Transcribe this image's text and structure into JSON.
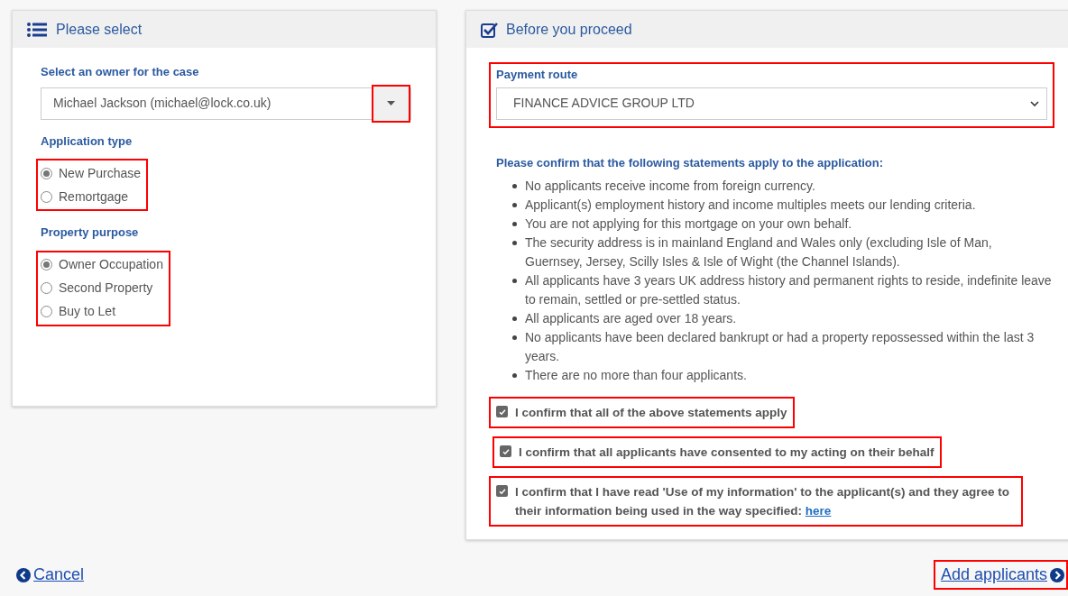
{
  "left_panel": {
    "title": "Please select",
    "owner": {
      "label": "Select an owner for the case",
      "value": "Michael Jackson (michael@lock.co.uk)",
      "button_highlighted": true
    },
    "radio_groups": [
      {
        "label": "Application type",
        "highlighted": true,
        "options": [
          {
            "label": "New Purchase",
            "selected": true
          },
          {
            "label": "Remortgage",
            "selected": false
          }
        ]
      },
      {
        "label": "Property purpose",
        "highlighted": true,
        "options": [
          {
            "label": "Owner Occupation",
            "selected": true
          },
          {
            "label": "Second Property",
            "selected": false
          },
          {
            "label": "Buy to Let",
            "selected": false
          }
        ]
      }
    ]
  },
  "right_panel": {
    "title": "Before you proceed",
    "payment_route": {
      "label": "Payment route",
      "value": "FINANCE ADVICE GROUP LTD",
      "highlighted": true
    },
    "statements_heading": "Please confirm that the following statements apply to the application:",
    "statements": [
      "No applicants receive income from foreign currency.",
      "Applicant(s) employment history and income multiples meets our lending criteria.",
      "You are not applying for this mortgage on your own behalf.",
      "The security address is in mainland England and Wales only (excluding Isle of Man, Guernsey, Jersey, Scilly Isles & Isle of Wight (the Channel Islands).",
      "All applicants have 3 years UK address history and permanent rights to reside, indefinite leave to remain, settled or pre-settled status.",
      "All applicants are aged over 18 years.",
      "No applicants have been declared bankrupt or had a property repossessed within the last 3 years.",
      "There are no more than four applicants."
    ],
    "confirmations": [
      {
        "text": "I confirm that all of the above statements apply",
        "checked": true,
        "highlighted": true
      },
      {
        "text": "I confirm that all applicants have consented to my acting on their behalf",
        "checked": true,
        "highlighted": true
      },
      {
        "text": "I confirm that I have read 'Use of my information' to the applicant(s) and they agree to their information being used in the way specified:",
        "link": "here",
        "checked": true,
        "highlighted": true
      }
    ]
  },
  "footer": {
    "cancel": "Cancel",
    "next": {
      "label": "Add applicants",
      "highlighted": true
    }
  }
}
